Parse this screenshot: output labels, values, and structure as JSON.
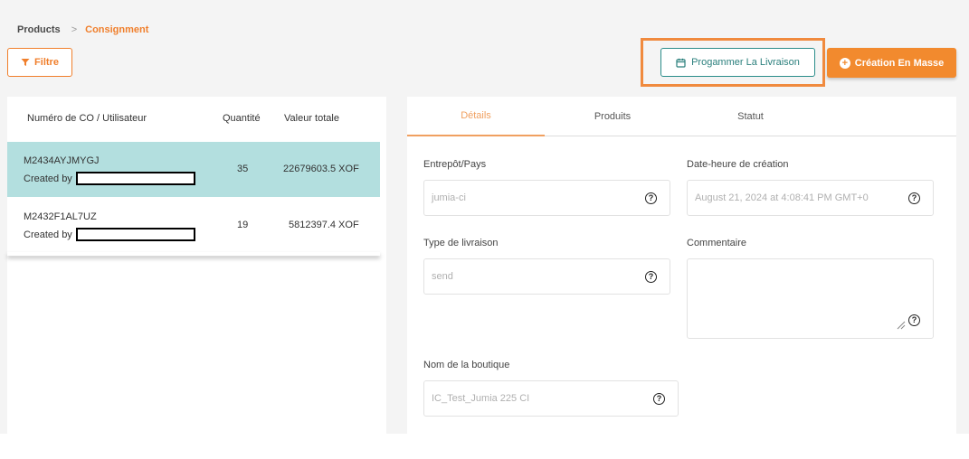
{
  "breadcrumb": {
    "root": "Products",
    "separator": ">",
    "current": "Consignment"
  },
  "toolbar": {
    "filter_label": "Filtre",
    "schedule_label": "Progammer La Livraison",
    "mass_create_label": "Création En Masse"
  },
  "icons": {
    "filter": "filter-icon",
    "calendar": "calendar-icon",
    "plus": "plus-circle-icon",
    "help": "help-circle-icon"
  },
  "colors": {
    "accent": "#f07f2c",
    "teal": "#2a8d8a",
    "selected_row": "#b3dfdf"
  },
  "list": {
    "columns": [
      "Numéro de CO / Utilisateur",
      "Quantité",
      "Valeur totale"
    ],
    "rows": [
      {
        "code": "M2434AYJMYGJ",
        "created_by": "Created by",
        "quantity": "35",
        "total": "22679603.5 XOF"
      },
      {
        "code": "M2432F1AL7UZ",
        "created_by": "Created by",
        "quantity": "19",
        "total": "5812397.4 XOF"
      }
    ]
  },
  "tabs": [
    "Détails",
    "Produits",
    "Statut"
  ],
  "details": {
    "warehouse": {
      "label": "Entrepôt/Pays",
      "value": "jumia-ci"
    },
    "created_at": {
      "label": "Date-heure de création",
      "value": "August 21, 2024 at 4:08:41 PM GMT+0"
    },
    "delivery_type": {
      "label": "Type de livraison",
      "value": "send"
    },
    "comment": {
      "label": "Commentaire",
      "value": ""
    },
    "shop_name": {
      "label": "Nom de la boutique",
      "value": "IC_Test_Jumia 225 CI"
    }
  }
}
